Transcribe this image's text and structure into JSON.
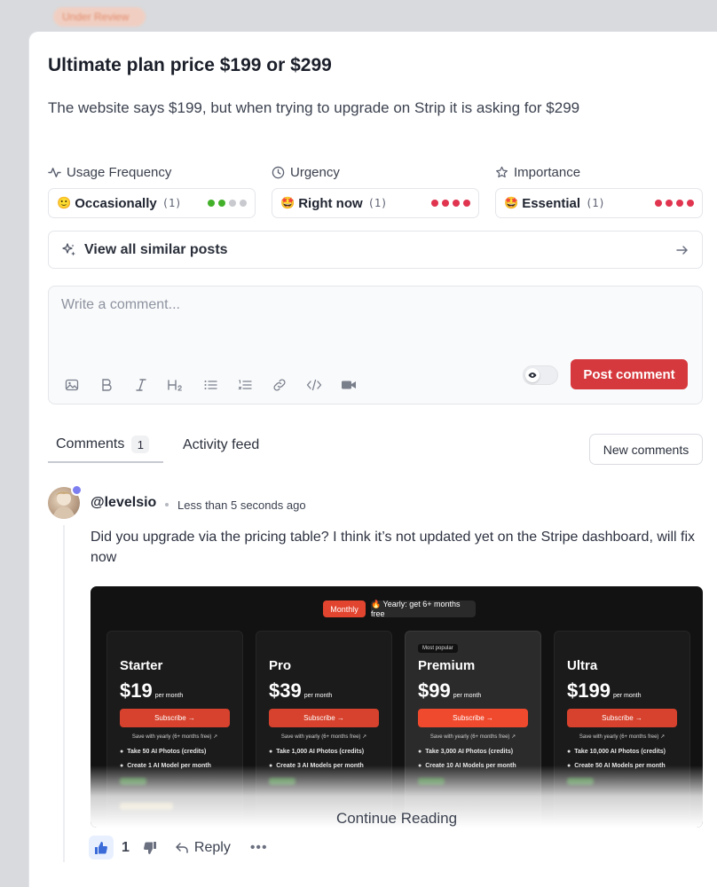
{
  "background": {
    "badge_label": "Under Review"
  },
  "post": {
    "title": "Ultimate plan price $199 or $299",
    "description": "The website says $199, but when trying to upgrade on Strip it is asking for $299"
  },
  "meta": [
    {
      "label": "Usage Frequency",
      "icon": "activity-icon",
      "emoji": "🙂",
      "value": "Occasionally",
      "count": "(1)",
      "dot_colors": [
        "#43b02a",
        "#43b02a",
        "#c8cacf",
        "#c8cacf"
      ]
    },
    {
      "label": "Urgency",
      "icon": "clock-icon",
      "emoji": "🤩",
      "value": "Right now",
      "count": "(1)",
      "dot_colors": [
        "#e0344f",
        "#e0344f",
        "#e0344f",
        "#e0344f"
      ]
    },
    {
      "label": "Importance",
      "icon": "star-icon",
      "emoji": "🤩",
      "value": "Essential",
      "count": "(1)",
      "dot_colors": [
        "#e0344f",
        "#e0344f",
        "#e0344f",
        "#e0344f"
      ]
    }
  ],
  "similar": {
    "label": "View all similar posts",
    "icon": "sparkles-icon"
  },
  "composer": {
    "placeholder": "Write a comment...",
    "toolbar": [
      "image-icon",
      "bold-icon",
      "italic-icon",
      "heading-icon",
      "bullet-list-icon",
      "numbered-list-icon",
      "link-icon",
      "code-icon",
      "video-icon"
    ],
    "post_label": "Post comment",
    "accent": "#d5393d"
  },
  "tabs": {
    "comments_label": "Comments",
    "comments_count": "1",
    "activity_label": "Activity feed",
    "new_comments_label": "New comments"
  },
  "comment": {
    "username": "@levelsio",
    "time": "Less than 5 seconds ago",
    "text": "Did you upgrade via the pricing table? I think it’s not updated yet on the Stripe dashboard, will fix now",
    "likes": "1",
    "reply_label": "Reply",
    "more_label": "•••"
  },
  "screenshot": {
    "toggle_monthly": "Monthly",
    "toggle_yearly": "🔥 Yearly: get 6+ months free",
    "most_popular": "Most popular",
    "per_month": "per month",
    "subscribe": "Subscribe →",
    "save_note": "Save with yearly (6+ months free) ↗",
    "continue_label": "Continue Reading",
    "plans": [
      {
        "name": "Starter",
        "price": "$19",
        "feat1": "Take 50 AI Photos (credits)",
        "feat2": "Create 1 AI Model per month"
      },
      {
        "name": "Pro",
        "price": "$39",
        "feat1": "Take 1,000 AI Photos (credits)",
        "feat2": "Create 3 AI Models per month"
      },
      {
        "name": "Premium",
        "price": "$99",
        "feat1": "Take 3,000 AI Photos (credits)",
        "feat2": "Create 10 AI Models per month"
      },
      {
        "name": "Ultra",
        "price": "$199",
        "feat1": "Take 10,000 AI Photos (credits)",
        "feat2": "Create 50 AI Models per month"
      }
    ]
  }
}
